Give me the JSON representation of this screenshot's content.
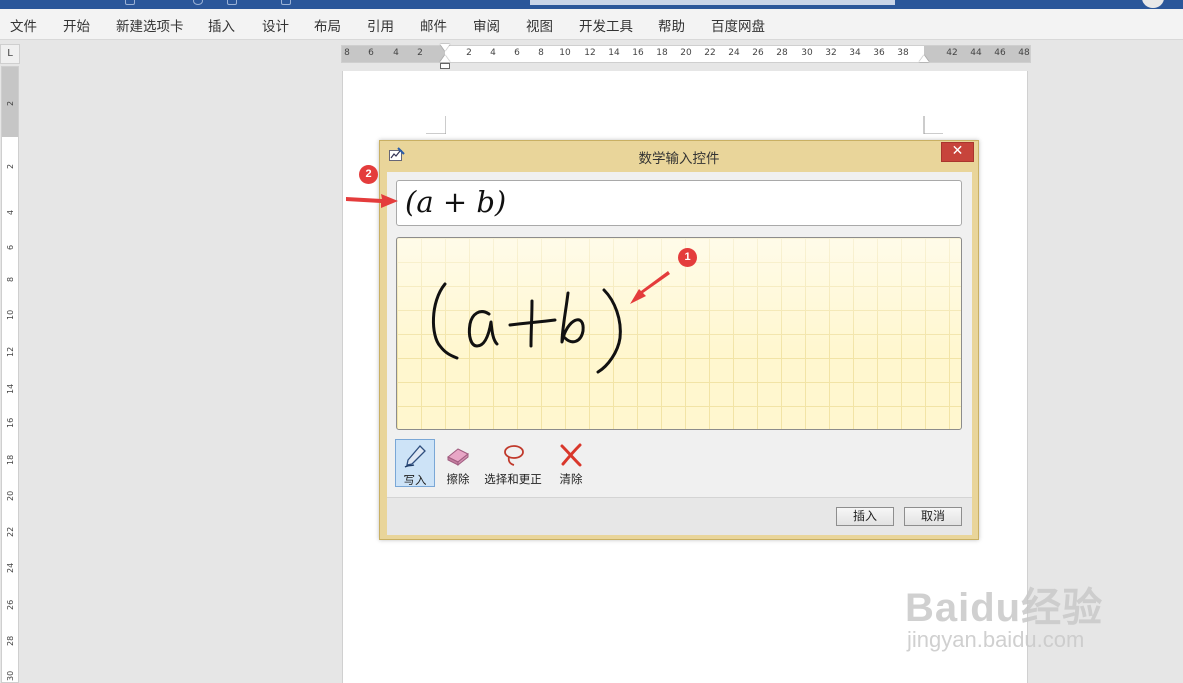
{
  "menu": {
    "items": [
      "文件",
      "开始",
      "新建选项卡",
      "插入",
      "设计",
      "布局",
      "引用",
      "邮件",
      "审阅",
      "视图",
      "开发工具",
      "帮助",
      "百度网盘"
    ]
  },
  "ruler": {
    "corner_label": "L",
    "horizontal_labels": [
      "8",
      "6",
      "4",
      "2",
      "2",
      "4",
      "6",
      "8",
      "10",
      "12",
      "14",
      "16",
      "18",
      "20",
      "22",
      "24",
      "26",
      "28",
      "30",
      "32",
      "34",
      "36",
      "38",
      "42",
      "44",
      "46",
      "48"
    ],
    "vertical_labels": [
      "2",
      "2",
      "4",
      "6",
      "8",
      "10",
      "12",
      "14",
      "16",
      "18",
      "20",
      "22",
      "24",
      "26",
      "28",
      "30"
    ]
  },
  "dialog": {
    "title": "数学输入控件",
    "close_glyph": "✕",
    "preview_formula": "(a + b)",
    "tools": [
      {
        "label": "写入",
        "icon": "pen-icon",
        "active": true
      },
      {
        "label": "擦除",
        "icon": "eraser-icon",
        "active": false
      },
      {
        "label": "选择和更正",
        "icon": "lasso-icon",
        "active": false
      },
      {
        "label": "清除",
        "icon": "clear-x-icon",
        "active": false
      }
    ],
    "insert_button": "插入",
    "cancel_button": "取消"
  },
  "annotations": {
    "marker_1": "1",
    "marker_2": "2",
    "color": "#e43c3c"
  },
  "watermark": {
    "brand": "Baidu经验",
    "url": "jingyan.baidu.com"
  },
  "colors": {
    "title_bar": "#2b579a",
    "dialog_frame": "#e9d59a",
    "close_button": "#c7443b",
    "ink_background": "#fff7cf"
  }
}
